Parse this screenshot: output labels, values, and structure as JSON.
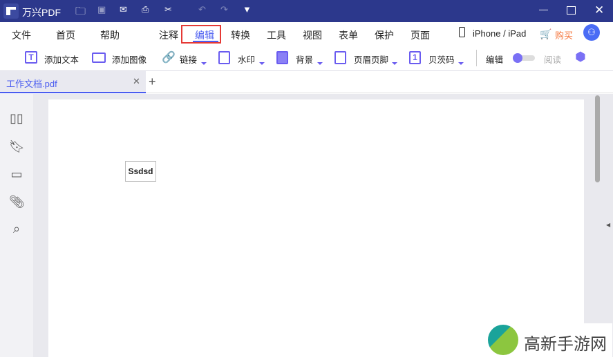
{
  "app": {
    "title": "万兴PDF"
  },
  "menu": [
    "文件",
    "首页",
    "帮助",
    "注释",
    "编辑",
    "转换",
    "工具",
    "视图",
    "表单",
    "保护",
    "页面"
  ],
  "device": "iPhone / iPad",
  "buy": "购买",
  "toolbar": {
    "add_text": "添加文本",
    "add_image": "添加图像",
    "link": "链接",
    "watermark": "水印",
    "background": "背景",
    "header_footer": "页眉页脚",
    "bates": "贝茨码",
    "edit": "编辑",
    "read": "阅读"
  },
  "tab": {
    "name": "工作文档.pdf"
  },
  "doc": {
    "text": "Ssdsd"
  },
  "watermark": "高新手游网",
  "colors": {
    "titlebar": "#2c388c",
    "accent": "#6a5cf0",
    "buy": "#f5753b"
  }
}
